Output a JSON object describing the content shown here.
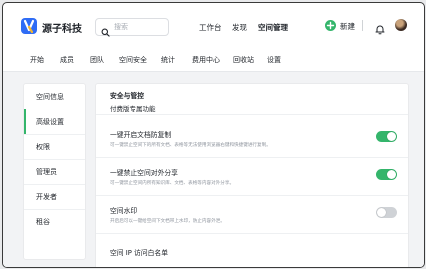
{
  "app": {
    "brand": "源子科技",
    "colors": {
      "accent": "#34b56b",
      "logo": "#2f6cf5"
    }
  },
  "header": {
    "search_placeholder": "搜索",
    "nav": [
      {
        "label": "工作台",
        "active": false
      },
      {
        "label": "发现",
        "active": false
      },
      {
        "label": "空间管理",
        "active": true
      }
    ],
    "new_label": "新建",
    "icons": [
      "search-icon",
      "plus-icon",
      "bell-icon",
      "avatar"
    ]
  },
  "subnav": {
    "items": [
      "开始",
      "成员",
      "团队",
      "空间安全",
      "统计",
      "费用中心",
      "回收站",
      "设置"
    ]
  },
  "sidebar": {
    "items": [
      {
        "label": "空间信息",
        "active": false
      },
      {
        "label": "高级设置",
        "active": true
      },
      {
        "label": "权限",
        "active": false
      },
      {
        "label": "管理员",
        "active": false
      },
      {
        "label": "开发者",
        "active": false
      },
      {
        "label": "租谷",
        "active": false
      }
    ]
  },
  "panel": {
    "section_title": "安全与管控",
    "section_subtitle": "付费版专属功能",
    "rows": [
      {
        "title": "一键开启文档防复制",
        "desc": "可一键禁止空间下的所有文档、表格等无法使用浏览器右键和快捷键进行复制。",
        "enabled": true
      },
      {
        "title": "一键禁止空间对外分享",
        "desc": "可一键禁止空间内所有知识库、文档、表格等内容对外分享。",
        "enabled": true
      },
      {
        "title": "空间水印",
        "desc": "开启后可以一键给空间下文档带上水印，防止内容外泄。",
        "enabled": false
      },
      {
        "title": "空间 IP 访问白名单",
        "desc": "",
        "enabled": false
      }
    ]
  }
}
